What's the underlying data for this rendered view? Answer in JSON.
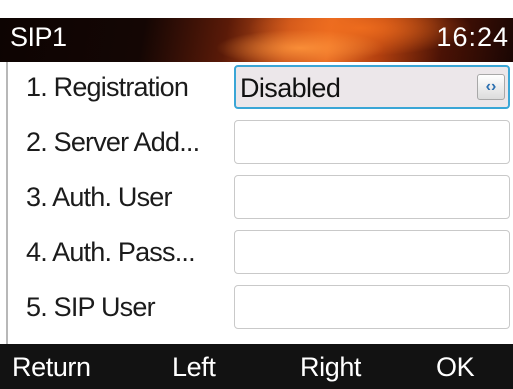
{
  "header": {
    "title": "SIP1",
    "time": "16:24"
  },
  "rows": [
    {
      "label": "1. Registration",
      "value": "Disabled",
      "toggle_icon": "‹›"
    },
    {
      "label": "2. Server Add...",
      "value": ""
    },
    {
      "label": "3. Auth. User",
      "value": ""
    },
    {
      "label": "4. Auth. Pass...",
      "value": ""
    },
    {
      "label": "5. SIP User",
      "value": ""
    }
  ],
  "softkeys": {
    "return": "Return",
    "left": "Left",
    "right": "Right",
    "ok": "OK"
  },
  "colors": {
    "accent": "#3aa6d6",
    "softkey_bar": "#121212",
    "title_glow": "#e86a22"
  }
}
